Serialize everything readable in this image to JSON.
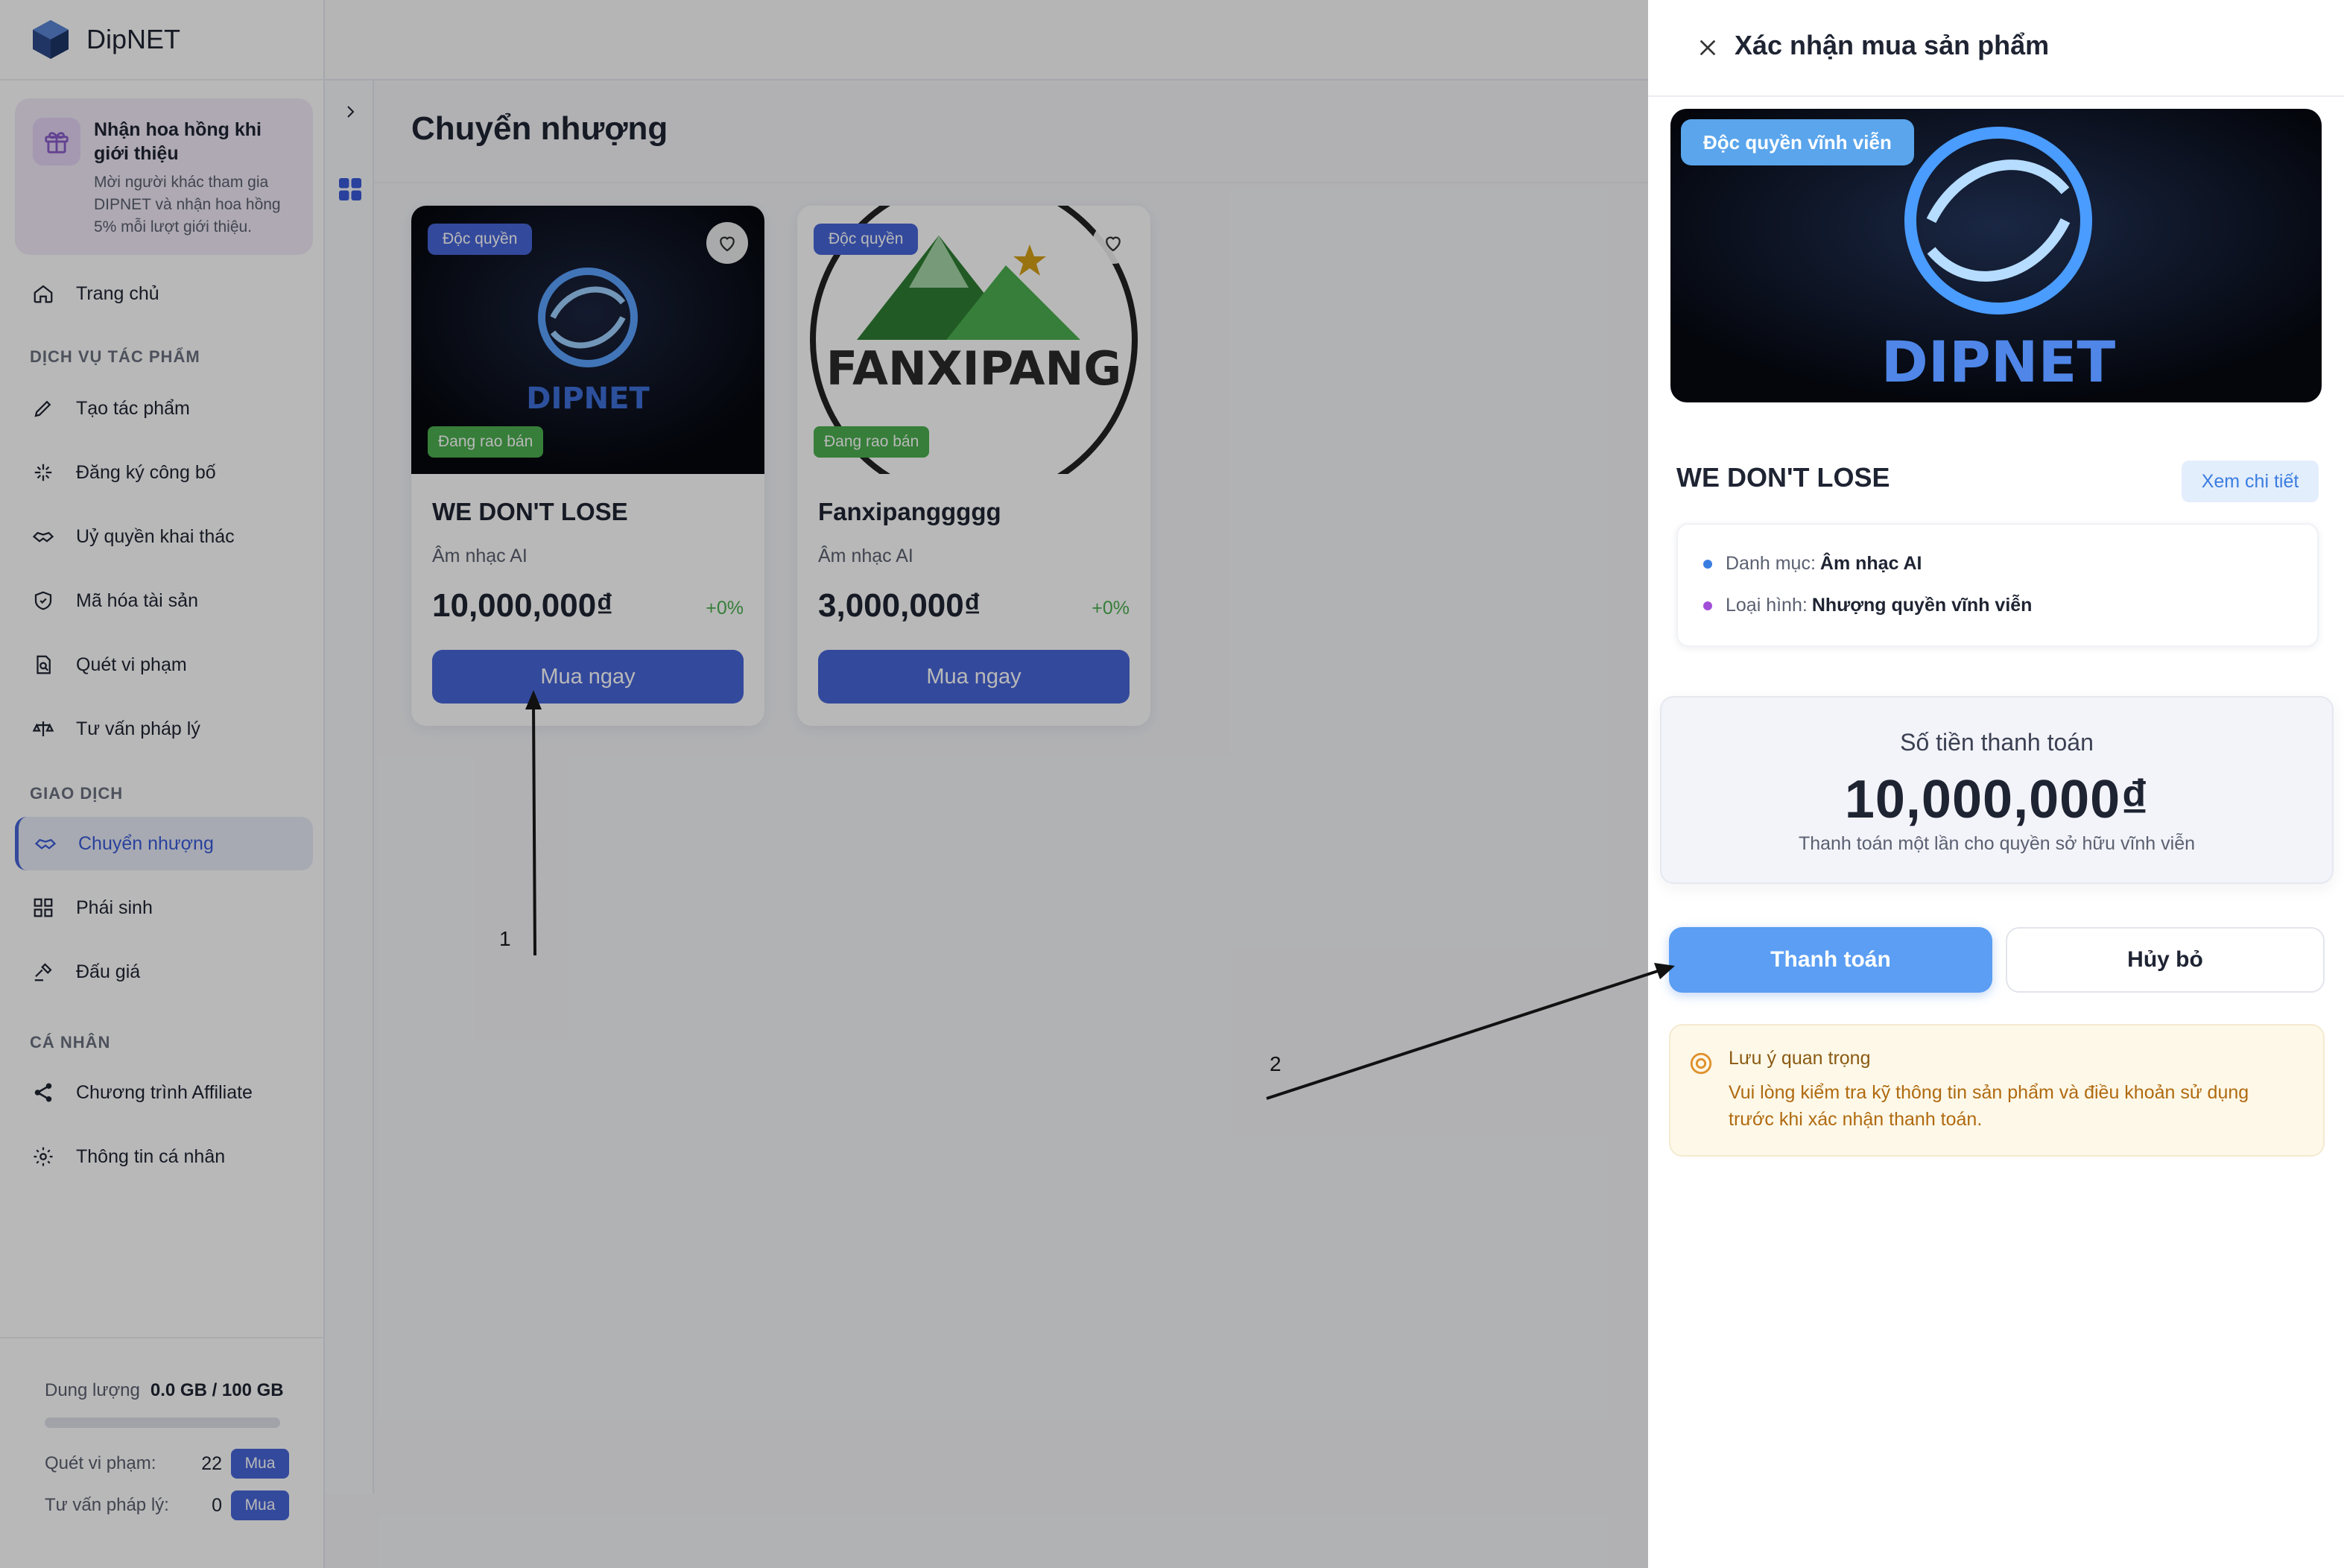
{
  "brand": {
    "name": "DipNET"
  },
  "promo": {
    "title": "Nhận hoa hồng khi giới thiệu",
    "description": "Mời người khác tham gia DIPNET và nhận hoa hồng 5% mỗi lượt giới thiệu."
  },
  "nav": {
    "home": "Trang chủ",
    "section_services": "DỊCH VỤ TÁC PHẨM",
    "create": "Tạo tác phẩm",
    "register": "Đăng ký công bố",
    "license": "Uỷ quyền khai thác",
    "encrypt": "Mã hóa tài sản",
    "scan": "Quét vi phạm",
    "legal": "Tư vấn pháp lý",
    "section_trading": "GIAO DỊCH",
    "transfer": "Chuyển nhượng",
    "derivative": "Phái sinh",
    "auction": "Đấu giá",
    "section_personal": "CÁ NHÂN",
    "affiliate": "Chương trình Affiliate",
    "profile": "Thông tin cá nhân"
  },
  "storage": {
    "label": "Dung lượng",
    "value": "0.0 GB / 100 GB",
    "fraction": 0.0,
    "scan_label": "Quét vi phạm:",
    "scan_count": "22",
    "legal_label": "Tư vấn pháp lý:",
    "legal_count": "0",
    "buy_label": "Mua"
  },
  "page": {
    "title": "Chuyển nhượng"
  },
  "cards": [
    {
      "badge": "Độc quyền",
      "status": "Đang rao bán",
      "logo_text": "DIPNET",
      "name": "WE DON'T LOSE",
      "category": "Âm nhạc AI",
      "price": "10,000,000₫",
      "change": "+0%",
      "buy": "Mua ngay"
    },
    {
      "badge": "Độc quyền",
      "status": "Đang rao bán",
      "logo_text": "FANXIPANG",
      "name": "Fanxipanggggg",
      "category": "Âm nhạc AI",
      "price": "3,000,000₫",
      "change": "+0%",
      "buy": "Mua ngay"
    }
  ],
  "drawer": {
    "title": "Xác nhận mua sản phẩm",
    "hero_badge": "Độc quyền vĩnh viễn",
    "hero_logo_text": "DIPNET",
    "product_name": "WE DON'T LOSE",
    "details_button": "Xem chi tiết",
    "category_label": "Danh mục:",
    "category_value": "Âm nhạc AI",
    "type_label": "Loại hình:",
    "type_value": "Nhượng quyền vĩnh viễn",
    "pay_label": "Số tiền thanh toán",
    "pay_amount": "10,000,000₫",
    "pay_note": "Thanh toán một lần cho quyền sở hữu vĩnh viễn",
    "pay_button": "Thanh toán",
    "cancel_button": "Hủy bỏ",
    "note_title": "Lưu ý quan trọng",
    "note_text": "Vui lòng kiểm tra kỹ thông tin sản phẩm và điều khoản sử dụng trước khi xác nhận thanh toán."
  },
  "annotations": {
    "label_1": "1",
    "label_2": "2"
  },
  "colors": {
    "primary": "#4766d8",
    "pay_button": "#5b9ef3",
    "success": "#4caf50",
    "warning_text": "#b06a10"
  }
}
